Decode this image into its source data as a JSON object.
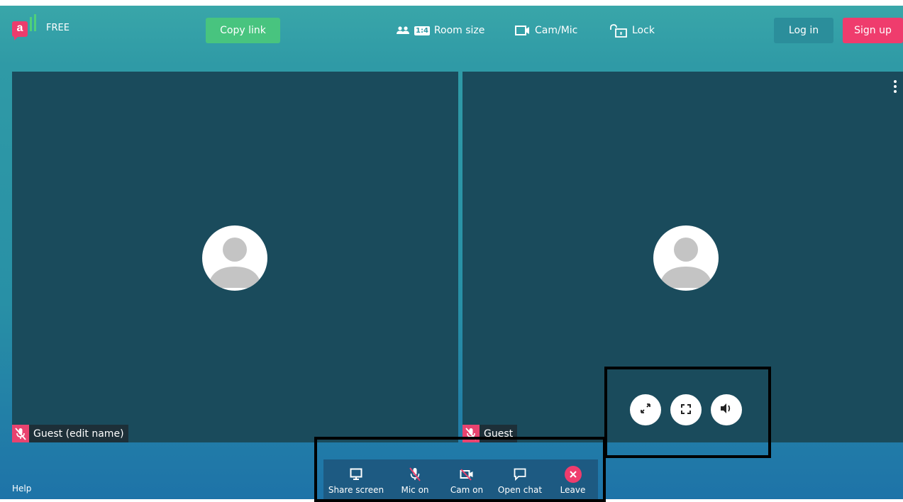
{
  "header": {
    "tier_label": "FREE",
    "copy_link_label": "Copy link",
    "room_size_label": "Room size",
    "room_size_badge": "1:4",
    "cam_mic_label": "Cam/Mic",
    "lock_label": "Lock",
    "login_label": "Log in",
    "signup_label": "Sign up"
  },
  "participants": [
    {
      "name": "Guest (edit name)",
      "muted": true
    },
    {
      "name": "Guest",
      "muted": true
    }
  ],
  "toolbar": {
    "share_screen": "Share screen",
    "mic": "Mic on",
    "cam": "Cam on",
    "chat": "Open chat",
    "leave": "Leave"
  },
  "footer": {
    "help": "Help"
  },
  "colors": {
    "brand_pink": "#ec3c6d",
    "brand_green": "#48c47f",
    "tile_bg": "#1a4b5c",
    "toolbar_bg": "#1d5a82"
  },
  "icons": [
    "people-icon",
    "camera-icon",
    "lock-icon",
    "kebab-menu-icon",
    "expand-icon",
    "fullscreen-icon",
    "volume-icon",
    "screen-icon",
    "mic-off-icon",
    "cam-off-icon",
    "chat-icon",
    "close-icon"
  ]
}
